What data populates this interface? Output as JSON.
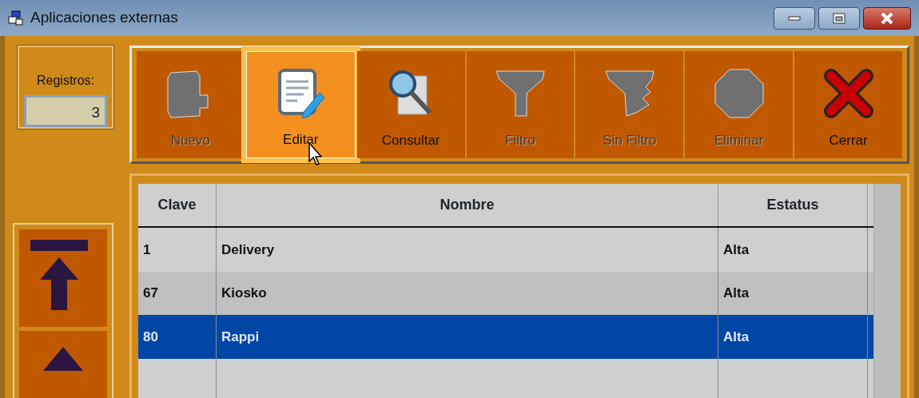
{
  "window": {
    "title": "Aplicaciones externas"
  },
  "records": {
    "label": "Registros:",
    "value": "3"
  },
  "toolbar": [
    {
      "label": "Nuevo",
      "disabled": true,
      "hovered": false
    },
    {
      "label": "Editar",
      "disabled": false,
      "hovered": true
    },
    {
      "label": "Consultar",
      "disabled": false,
      "hovered": false
    },
    {
      "label": "Filtro",
      "disabled": true,
      "hovered": false
    },
    {
      "label": "Sin Filtro",
      "disabled": true,
      "hovered": false
    },
    {
      "label": "Eliminar",
      "disabled": true,
      "hovered": false
    },
    {
      "label": "Cerrar",
      "disabled": false,
      "hovered": false
    }
  ],
  "table": {
    "columns": [
      "Clave",
      "Nombre",
      "Estatus"
    ],
    "rows": [
      {
        "cells": [
          "1",
          "Delivery",
          "Alta"
        ],
        "selected": false
      },
      {
        "cells": [
          "67",
          "Kiosko",
          "Alta"
        ],
        "selected": false
      },
      {
        "cells": [
          "80",
          "Rappi",
          "Alta"
        ],
        "selected": true
      }
    ]
  }
}
